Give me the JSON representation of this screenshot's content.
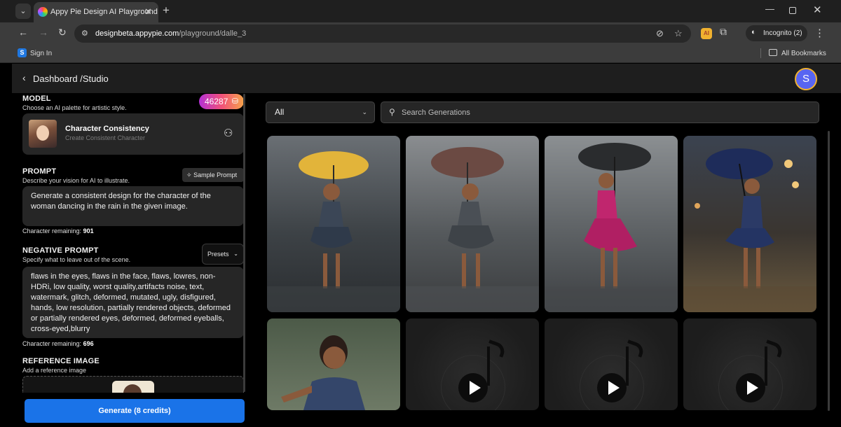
{
  "browser": {
    "tab_title": "Appy Pie Design AI Playground",
    "url_host": "designbeta.appypie.com",
    "url_path": "/playground/dalle_3",
    "incognito_label": "Incognito (2)",
    "bookmark_signin": "Sign In",
    "bookmark_all": "All Bookmarks"
  },
  "header": {
    "breadcrumb": "Dashboard /Studio",
    "avatar_initial": "S"
  },
  "model": {
    "title": "MODEL",
    "subtitle": "Choose an AI palette for artistic style.",
    "credits": "46287",
    "name": "Character Consistency",
    "description": "Create Consistent Character"
  },
  "prompt": {
    "title": "PROMPT",
    "subtitle": "Describe your vision for AI to illustrate.",
    "sample_label": "Sample Prompt",
    "text": "Generate a consistent design for the character of the woman dancing in the rain in the given image.",
    "remaining_label": "Character remaining:",
    "remaining_value": "901"
  },
  "negative_prompt": {
    "title": "NEGATIVE PROMPT",
    "subtitle": "Specify what to leave out of the scene.",
    "presets_label": "Presets",
    "text": "flaws in the eyes, flaws in the face, flaws, lowres, non-HDRi, low quality, worst quality,artifacts noise, text, watermark, glitch, deformed, mutated, ugly, disfigured, hands, low resolution, partially rendered objects,  deformed or partially rendered eyes, deformed, deformed eyeballs, cross-eyed,blurry",
    "remaining_label": "Character remaining:",
    "remaining_value": "696"
  },
  "reference": {
    "title": "REFERENCE IMAGE",
    "subtitle": "Add a reference image"
  },
  "generate_label": "Generate (8 credits)",
  "gallery": {
    "filter_value": "All",
    "search_placeholder": "Search Generations"
  },
  "colors": {
    "accent_blue": "#1a73e8",
    "avatar": "#5865f2",
    "avatar_ring": "#f0b12f",
    "panel": "#262626"
  }
}
